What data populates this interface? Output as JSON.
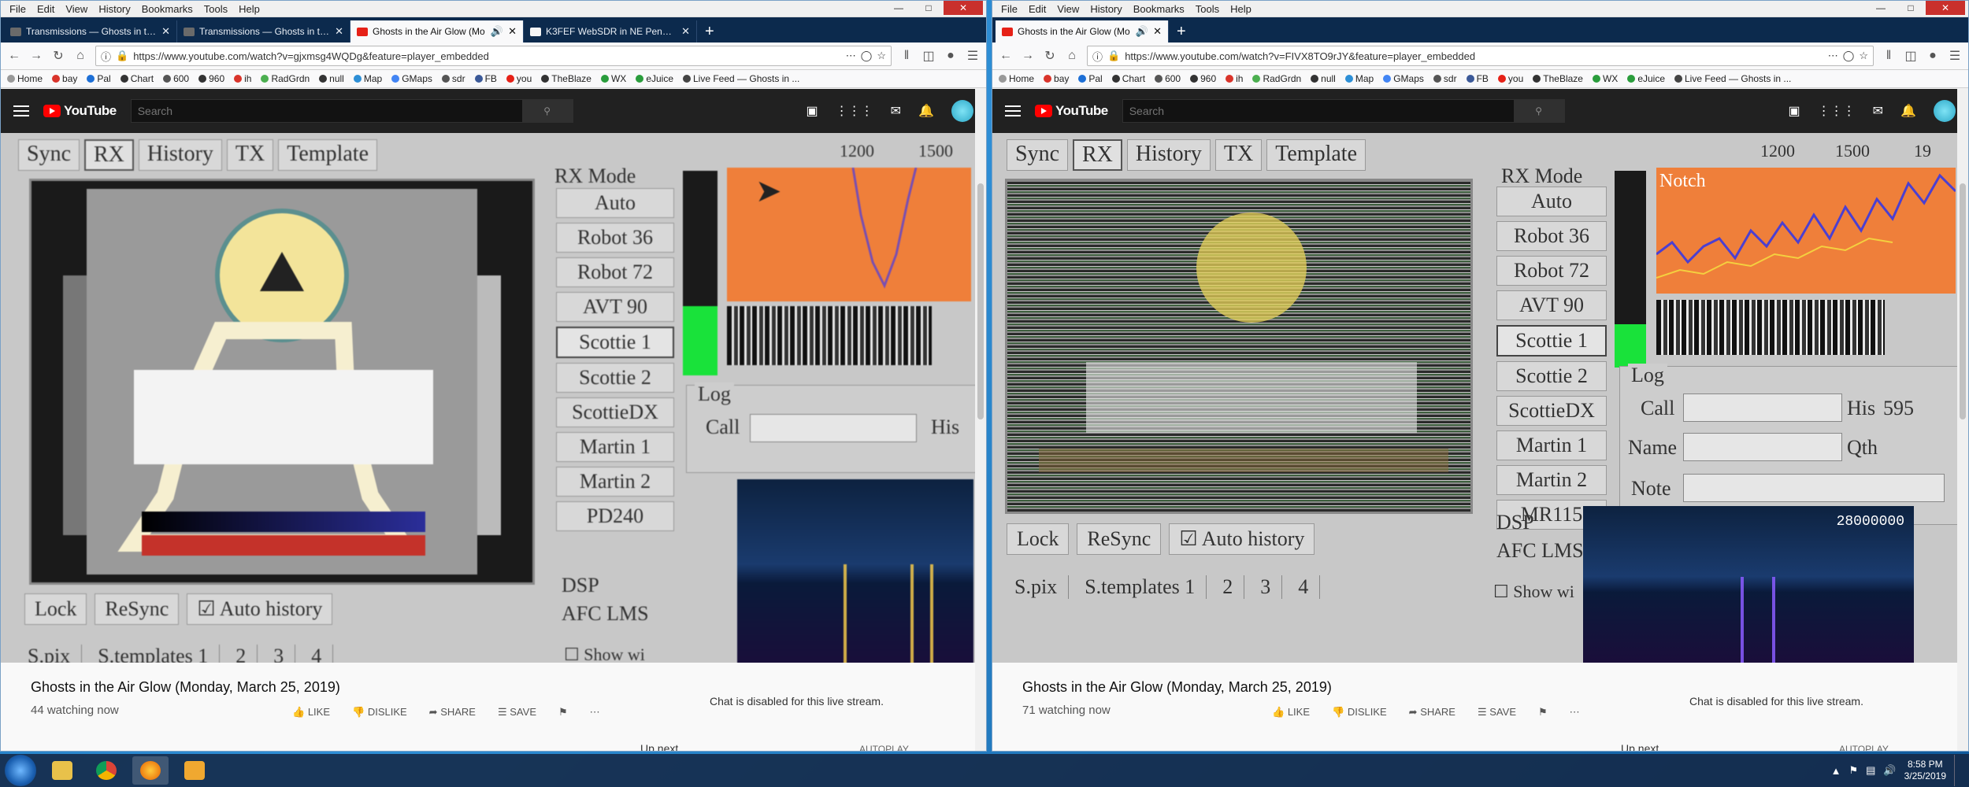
{
  "menu": [
    "File",
    "Edit",
    "View",
    "History",
    "Bookmarks",
    "Tools",
    "Help"
  ],
  "bookmarks": [
    {
      "label": "Home",
      "color": "#999999"
    },
    {
      "label": "bay",
      "color": "#d9342b"
    },
    {
      "label": "Pal",
      "color": "#1d6fd6"
    },
    {
      "label": "Chart",
      "color": "#333333"
    },
    {
      "label": "600",
      "color": "#555555"
    },
    {
      "label": "960",
      "color": "#333333"
    },
    {
      "label": "ih",
      "color": "#d9342b"
    },
    {
      "label": "RadGrdn",
      "color": "#4caf50"
    },
    {
      "label": "null",
      "color": "#333333"
    },
    {
      "label": "Map",
      "color": "#2d8fd6"
    },
    {
      "label": "GMaps",
      "color": "#4285f4"
    },
    {
      "label": "sdr",
      "color": "#555555"
    },
    {
      "label": "FB",
      "color": "#3b5998"
    },
    {
      "label": "you",
      "color": "#e62117"
    },
    {
      "label": "TheBlaze",
      "color": "#333333"
    },
    {
      "label": "WX",
      "color": "#2a9d3c"
    },
    {
      "label": "eJuice",
      "color": "#2a9d3c"
    },
    {
      "label": "Live Feed — Ghosts in ...",
      "color": "#444444"
    }
  ],
  "left": {
    "tabs": [
      {
        "label": "Transmissions — Ghosts in the",
        "icon": "#6a6a6a"
      },
      {
        "label": "Transmissions — Ghosts in the",
        "icon": "#6a6a6a"
      },
      {
        "label": "Ghosts in the Air Glow (Mo",
        "icon": "#e62117"
      },
      {
        "label": "K3FEF WebSDR in NE Pennsylv",
        "icon": "#f5f5f5"
      }
    ],
    "url": "https://www.youtube.com/watch?v=gjxmsg4WQDg&feature=player_embedded",
    "sstv": {
      "tabs": [
        "Sync",
        "RX",
        "History",
        "TX",
        "Template"
      ],
      "rxmode": "RX Mode",
      "modes": [
        "Auto",
        "Robot 36",
        "Robot 72",
        "AVT 90",
        "Scottie 1",
        "Scottie 2",
        "ScottieDX",
        "Martin 1",
        "Martin 2",
        "PD240"
      ],
      "scale": [
        "1200",
        "1500"
      ],
      "log": "Log",
      "call": "Call",
      "his": "His",
      "buttons": [
        "Lock",
        "ReSync",
        "Auto history"
      ],
      "dsp": "DSP",
      "dspopts": "AFC  LMS",
      "showwf": "Show wi",
      "spix": [
        "S.pix",
        "S.templates 1",
        "2",
        "3",
        "4"
      ]
    },
    "title": "Ghosts in the Air Glow (Monday, March 25, 2019)",
    "watching": "44 watching now",
    "like": "LIKE",
    "dislike": "DISLIKE",
    "share": "SHARE",
    "save": "SAVE",
    "chat": "Chat is disabled for this live stream.",
    "upnext": "Up next",
    "autoplay": "AUTOPLAY"
  },
  "right": {
    "tabs": [
      {
        "label": "Ghosts in the Air Glow (Mo",
        "icon": "#e62117"
      }
    ],
    "url": "https://www.youtube.com/watch?v=FIVX8TO9rJY&feature=player_embedded",
    "sstv": {
      "tabs": [
        "Sync",
        "RX",
        "History",
        "TX",
        "Template"
      ],
      "rxmode": "RX Mode",
      "modes": [
        "Auto",
        "Robot 36",
        "Robot 72",
        "AVT 90",
        "Scottie 1",
        "Scottie 2",
        "ScottieDX",
        "Martin 1",
        "Martin 2",
        "MR115"
      ],
      "scale": [
        "1200",
        "1500",
        "19"
      ],
      "notch": "Notch",
      "log": "Log",
      "call": "Call",
      "his": "His",
      "his_value": "595",
      "name": "Name",
      "qth": "Qth",
      "note": "Note",
      "buttons": [
        "Lock",
        "ReSync",
        "Auto history"
      ],
      "dsp": "DSP",
      "dspopts": "AFC  LMS",
      "showwf": "Show wi",
      "sdrfreq": "28000000",
      "spix": [
        "S.pix",
        "S.templates 1",
        "2",
        "3",
        "4"
      ]
    },
    "title": "Ghosts in the Air Glow (Monday, March 25, 2019)",
    "watching": "71 watching now",
    "like": "LIKE",
    "dislike": "DISLIKE",
    "share": "SHARE",
    "save": "SAVE",
    "chat": "Chat is disabled for this live stream.",
    "upnext": "Up next",
    "autoplay": "AUTOPLAY"
  },
  "search_placeholder": "Search",
  "clock": {
    "time": "8:58 PM",
    "date": "3/25/2019"
  },
  "taskbar_icons": [
    "explorer",
    "chrome",
    "firefox",
    "camera"
  ]
}
